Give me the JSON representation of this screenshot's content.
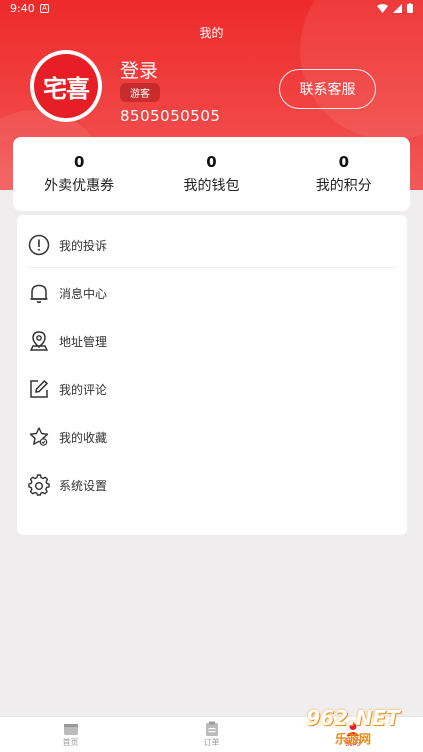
{
  "status_bar": {
    "time": "9:40"
  },
  "header": {
    "title": "我的",
    "logo_text": "宅喜",
    "login_label": "登录",
    "guest_badge": "游客",
    "phone": "8505050505",
    "contact_button": "联系客服"
  },
  "stats": [
    {
      "value": "0",
      "label": "外卖优惠券"
    },
    {
      "value": "0",
      "label": "我的钱包"
    },
    {
      "value": "0",
      "label": "我的积分"
    }
  ],
  "menu": [
    {
      "label": "我的投诉",
      "icon": "alert-circle-icon"
    },
    {
      "label": "消息中心",
      "icon": "bell-icon"
    },
    {
      "label": "地址管理",
      "icon": "location-pin-icon"
    },
    {
      "label": "我的评论",
      "icon": "edit-icon"
    },
    {
      "label": "我的收藏",
      "icon": "star-icon"
    },
    {
      "label": "系统设置",
      "icon": "gear-icon"
    }
  ],
  "tabbar": [
    {
      "label": "首页",
      "icon": "home-icon"
    },
    {
      "label": "订单",
      "icon": "clipboard-icon"
    },
    {
      "label": "我的",
      "icon": "user-icon"
    }
  ],
  "watermark": {
    "top": "962.NET",
    "bottom": "乐游网"
  },
  "colors": {
    "brand_red": "#e71e25",
    "header_gradient_top": "#ee2a2a",
    "background": "#efeded"
  }
}
